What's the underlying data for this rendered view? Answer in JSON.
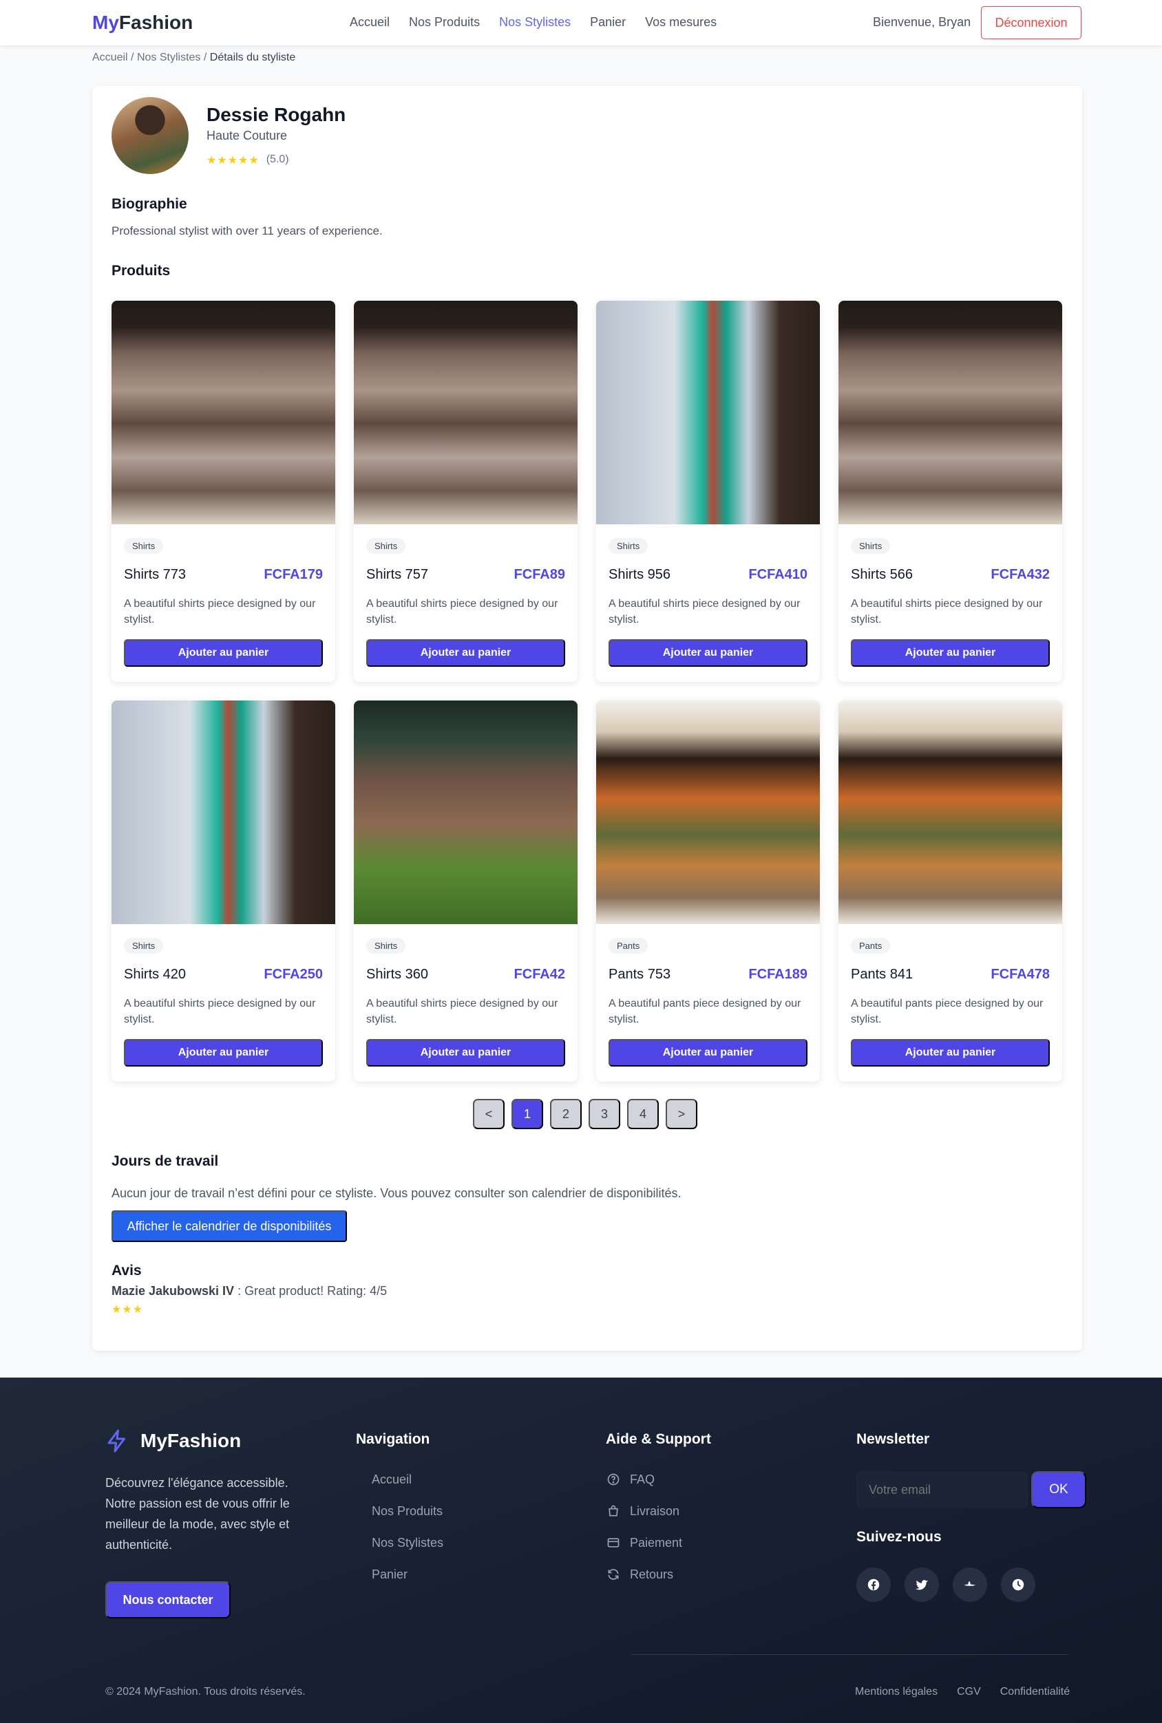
{
  "navbar": {
    "brand_prefix": "My",
    "brand_suffix": "Fashion",
    "links": [
      "Accueil",
      "Nos Produits",
      "Nos Stylistes",
      "Panier",
      "Vos mesures"
    ],
    "active_link": "Nos Stylistes",
    "welcome": "Bienvenue, Bryan",
    "logout": "Déconnexion"
  },
  "breadcrumb": {
    "home": "Accueil",
    "stylists": "Nos Stylistes",
    "current": "Détails du styliste",
    "separator": "/"
  },
  "stylist": {
    "name": "Dessie Rogahn",
    "specialty": "Haute Couture",
    "stars": "★★★★★",
    "rating": "(5.0)",
    "bio_title": "Biographie",
    "bio": "Professional stylist with over 11 years of experience."
  },
  "products_section": {
    "title": "Produits",
    "items": [
      {
        "category": "Shirts",
        "name": "Shirts 773",
        "price": "FCFA179",
        "description": "A beautiful shirts piece designed by our stylist.",
        "button": "Ajouter au panier"
      },
      {
        "category": "Shirts",
        "name": "Shirts 757",
        "price": "FCFA89",
        "description": "A beautiful shirts piece designed by our stylist.",
        "button": "Ajouter au panier"
      },
      {
        "category": "Shirts",
        "name": "Shirts 956",
        "price": "FCFA410",
        "description": "A beautiful shirts piece designed by our stylist.",
        "button": "Ajouter au panier"
      },
      {
        "category": "Shirts",
        "name": "Shirts 566",
        "price": "FCFA432",
        "description": "A beautiful shirts piece designed by our stylist.",
        "button": "Ajouter au panier"
      },
      {
        "category": "Shirts",
        "name": "Shirts 420",
        "price": "FCFA250",
        "description": "A beautiful shirts piece designed by our stylist.",
        "button": "Ajouter au panier"
      },
      {
        "category": "Shirts",
        "name": "Shirts 360",
        "price": "FCFA42",
        "description": "A beautiful shirts piece designed by our stylist.",
        "button": "Ajouter au panier"
      },
      {
        "category": "Pants",
        "name": "Pants 753",
        "price": "FCFA189",
        "description": "A beautiful pants piece designed by our stylist.",
        "button": "Ajouter au panier"
      },
      {
        "category": "Pants",
        "name": "Pants 841",
        "price": "FCFA478",
        "description": "A beautiful pants piece designed by our stylist.",
        "button": "Ajouter au panier"
      }
    ]
  },
  "pagination": {
    "prev": "<",
    "pages": [
      "1",
      "2",
      "3",
      "4"
    ],
    "current": "1",
    "next": ">"
  },
  "workdays": {
    "title": "Jours de travail",
    "message": "Aucun jour de travail n’est défini pour ce styliste. Vous pouvez consulter son calendrier de disponibilités.",
    "button": "Afficher le calendrier de disponibilités"
  },
  "reviews": {
    "title": "Avis",
    "items": [
      {
        "reviewer": "Mazie Jakubowski IV",
        "text": " : Great product! Rating: 4/5",
        "stars": "★★★"
      }
    ]
  },
  "footer": {
    "brand": "MyFashion",
    "about": "Découvrez l'élégance accessible. Notre passion est de vous offrir le meilleur de la mode, avec style et authenticité.",
    "contact_button": "Nous contacter",
    "nav_title": "Navigation",
    "nav_links": [
      "Accueil",
      "Nos Produits",
      "Nos Stylistes",
      "Panier"
    ],
    "support_title": "Aide & Support",
    "support_links": [
      "FAQ",
      "Livraison",
      "Paiement",
      "Retours"
    ],
    "newsletter_title": "Newsletter",
    "newsletter_placeholder": "Votre email",
    "newsletter_button": "OK",
    "social_title": "Suivez-nous",
    "social_icons": [
      "facebook-icon",
      "twitter-icon",
      "hat-icon",
      "clock-icon"
    ],
    "copyright": "© 2024 MyFashion. Tous droits réservés.",
    "legal_links": [
      "Mentions légales",
      "CGV",
      "Confidentialité"
    ]
  },
  "colors": {
    "accent": "#4f46e5",
    "nav_active": "#6366f1",
    "logout": "#ef4444",
    "calendar_button": "#2563eb",
    "star": "#facc15",
    "footer_bg": "#1f2937"
  }
}
